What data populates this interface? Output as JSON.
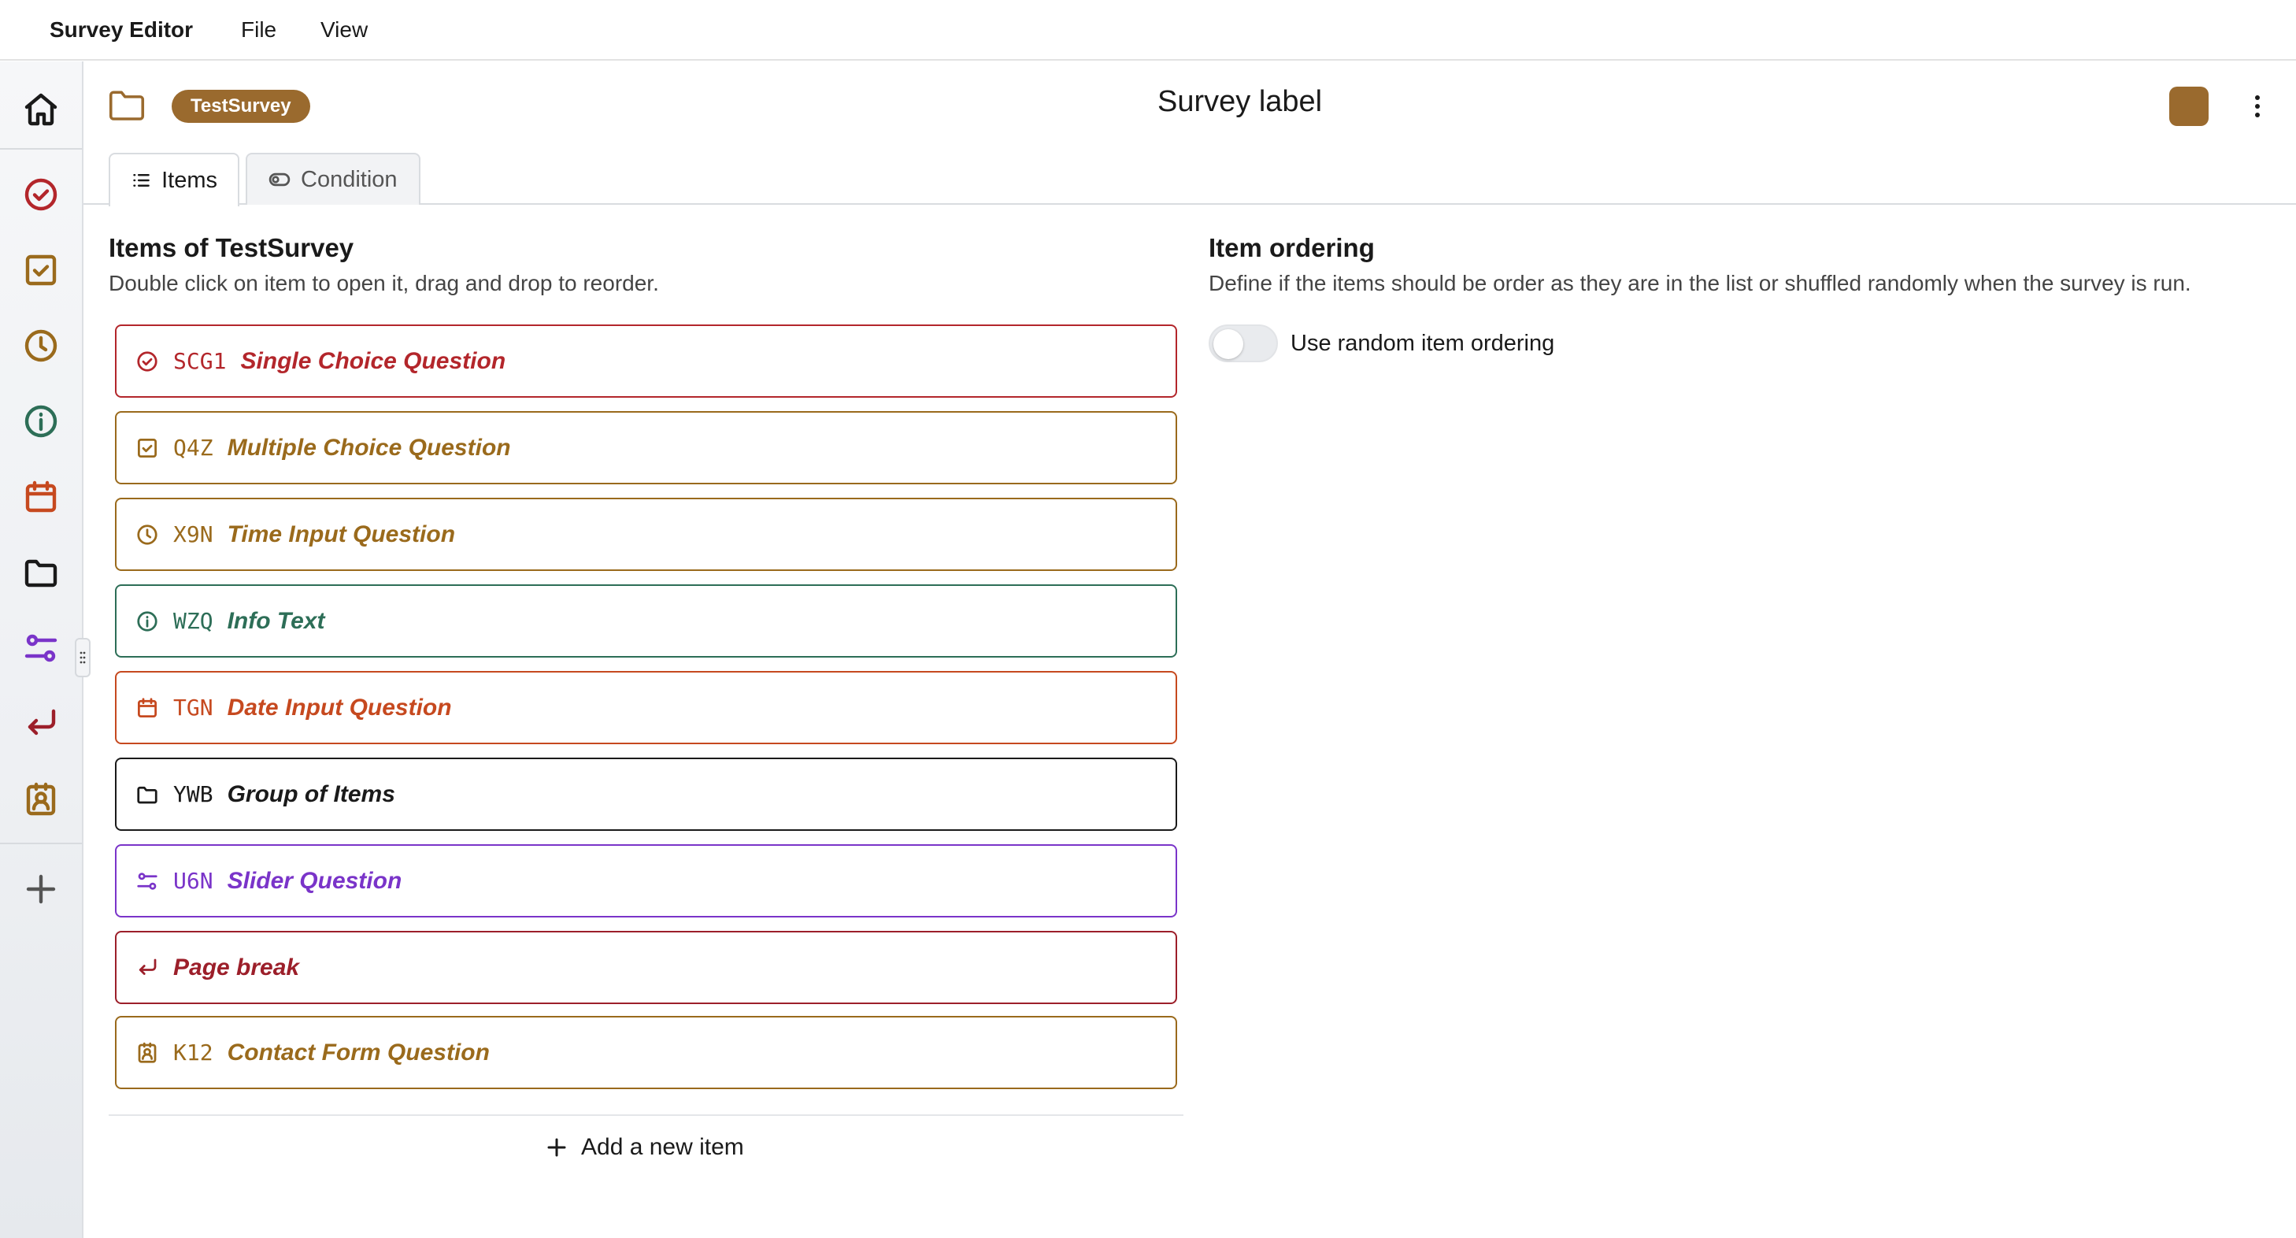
{
  "menubar": {
    "app_title": "Survey Editor",
    "file": "File",
    "view": "View"
  },
  "sidebar": {
    "items": [
      {
        "name": "home-icon",
        "color": "#1a1a1a"
      },
      {
        "name": "single-choice-icon",
        "color": "#b3262b"
      },
      {
        "name": "multiple-choice-icon",
        "color": "#9a6a1c"
      },
      {
        "name": "clock-icon",
        "color": "#9a6a1c"
      },
      {
        "name": "info-icon",
        "color": "#2d6e57"
      },
      {
        "name": "calendar-icon",
        "color": "#c6491f"
      },
      {
        "name": "folder-icon",
        "color": "#1a1a1a"
      },
      {
        "name": "slider-icon",
        "color": "#7a34c9"
      },
      {
        "name": "page-break-icon",
        "color": "#9c1f2a"
      },
      {
        "name": "contact-icon",
        "color": "#9a6a1c"
      },
      {
        "name": "add-icon",
        "color": "#555555"
      }
    ]
  },
  "header": {
    "survey_key": "TestSurvey",
    "survey_label": "Survey label",
    "accent_color": "#9a6a2e"
  },
  "tabs": [
    {
      "label": "Items",
      "icon": "list-icon",
      "active": true
    },
    {
      "label": "Condition",
      "icon": "toggle-icon",
      "active": false
    }
  ],
  "items_panel": {
    "title": "Items of TestSurvey",
    "subtitle": "Double click on item to open it, drag and drop to reorder.",
    "items": [
      {
        "key": "SCG1",
        "label": "Single Choice Question",
        "icon": "single-choice-icon",
        "color": "#b3262b"
      },
      {
        "key": "Q4Z",
        "label": "Multiple Choice Question",
        "icon": "multiple-choice-icon",
        "color": "#9a6a1c"
      },
      {
        "key": "X9N",
        "label": "Time Input Question",
        "icon": "clock-icon",
        "color": "#9a6a1c"
      },
      {
        "key": "WZQ",
        "label": "Info Text",
        "icon": "info-icon",
        "color": "#2d6e57"
      },
      {
        "key": "TGN",
        "label": "Date Input Question",
        "icon": "calendar-icon",
        "color": "#c6491f"
      },
      {
        "key": "YWB",
        "label": "Group of Items",
        "icon": "folder-icon",
        "color": "#1a1a1a"
      },
      {
        "key": "U6N",
        "label": "Slider Question",
        "icon": "slider-icon",
        "color": "#7a34c9"
      },
      {
        "key": "",
        "label": "Page break",
        "icon": "page-break-icon",
        "color": "#9c1f2a"
      },
      {
        "key": "K12",
        "label": "Contact Form Question",
        "icon": "contact-icon",
        "color": "#9a6a1c"
      }
    ],
    "add_label": "Add a new item"
  },
  "ordering_panel": {
    "title": "Item ordering",
    "subtitle": "Define if the items should be order as they are in the list or shuffled randomly when the survey is run.",
    "toggle_label": "Use random item ordering",
    "toggle_on": false
  }
}
